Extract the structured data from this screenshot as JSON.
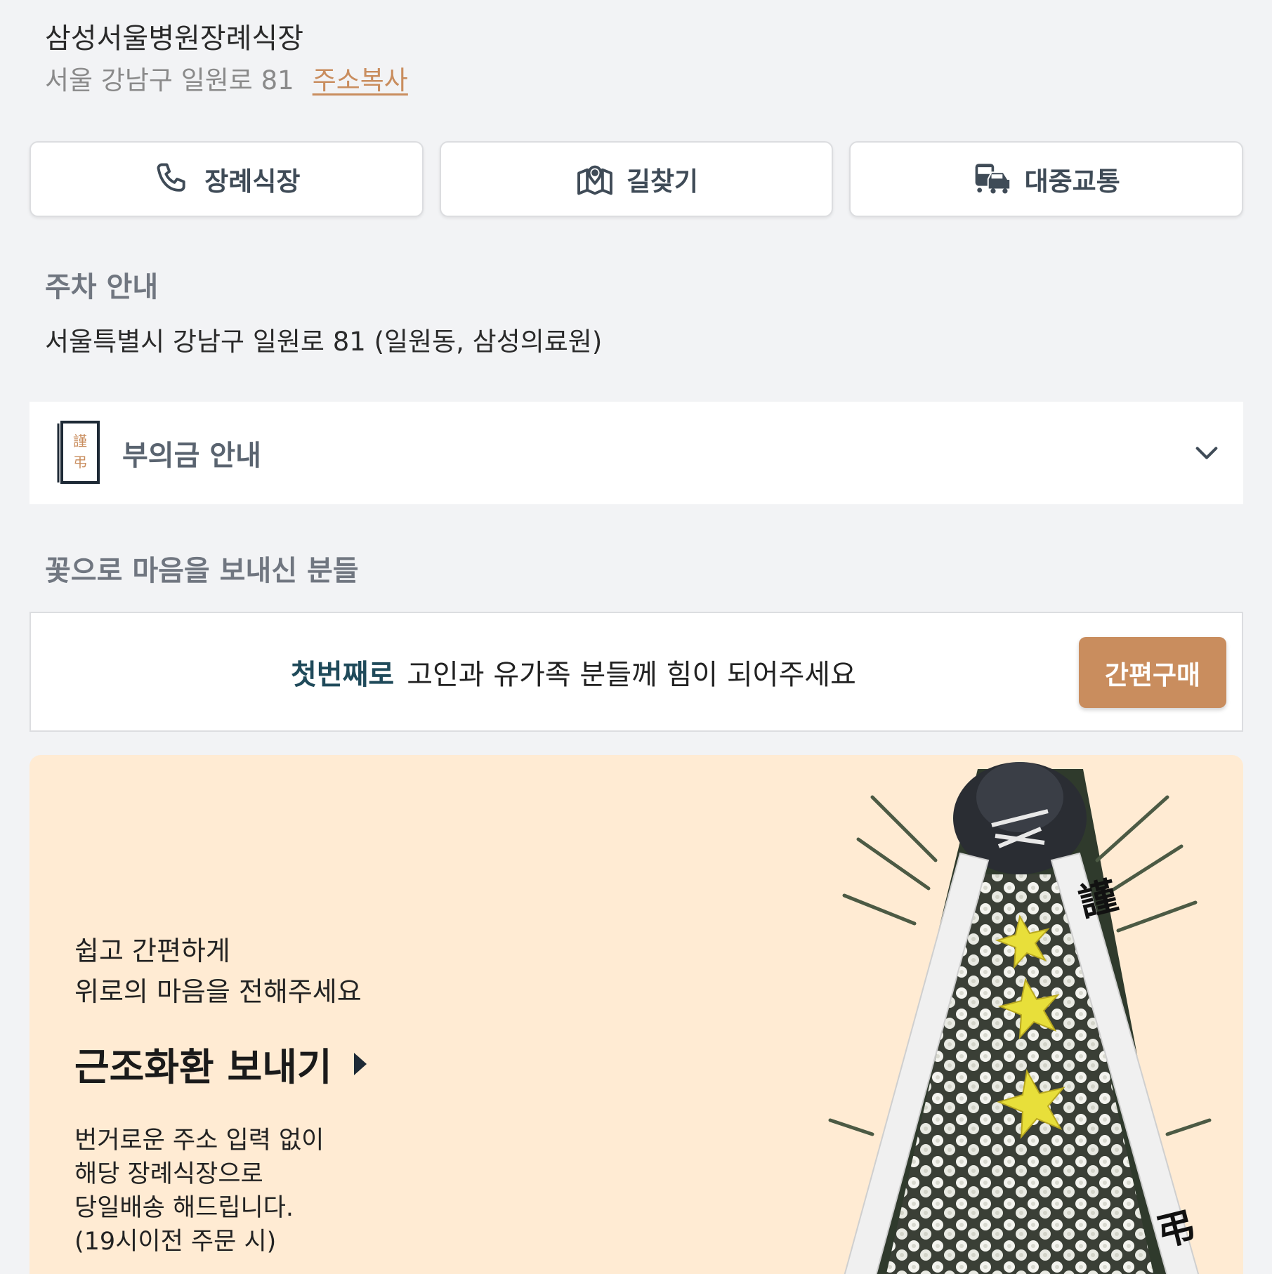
{
  "header": {
    "venue_name": "삼성서울병원장례식장",
    "address": "서울 강남구 일원로 81",
    "copy_address_label": "주소복사"
  },
  "actions": [
    {
      "label": "장례식장",
      "icon": "phone-icon"
    },
    {
      "label": "길찾기",
      "icon": "map-pin-icon"
    },
    {
      "label": "대중교통",
      "icon": "bus-car-icon"
    }
  ],
  "parking": {
    "title": "주차 안내",
    "text": "서울특별시 강남구 일원로 81 (일원동, 삼성의료원)"
  },
  "condolence": {
    "label": "부의금 안내",
    "icon": "condolence-envelope-icon",
    "icon_chars": [
      "謹",
      "弔"
    ]
  },
  "flowers": {
    "title": "꽃으로 마음을 보내신 분들",
    "first_accent": "첫번째로",
    "first_text": "고인과 유가족 분들께 힘이 되어주세요",
    "quick_buy_label": "간편구매"
  },
  "promo": {
    "subtitle_line1": "쉽고 간편하게",
    "subtitle_line2": "위로의 마음을 전해주세요",
    "cta_label": "근조화환 보내기",
    "desc_line1": "번거로운 주소 입력 없이",
    "desc_line2": "해당 장례식장으로",
    "desc_line3": "당일배송 해드립니다.",
    "desc_line4": "(19시이전 주문 시)",
    "ribbon_chars": [
      "謹",
      "弔"
    ]
  },
  "colors": {
    "background": "#f2f3f5",
    "accent_brown": "#c98d5e",
    "accent_navy": "#1f4a5a",
    "promo_bg": "#ffebd3"
  }
}
